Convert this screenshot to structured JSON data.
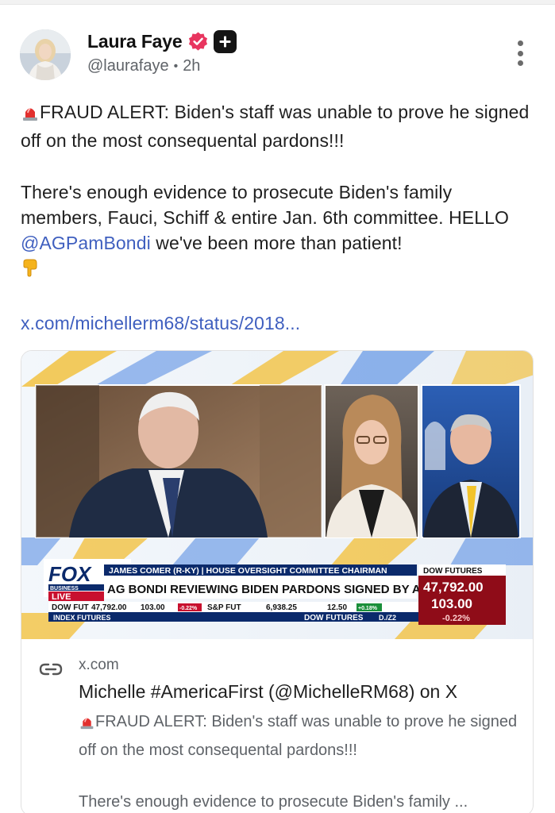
{
  "post": {
    "author": {
      "name": "Laura Faye",
      "handle": "@laurafaye",
      "time": "2h"
    },
    "body": {
      "p1_prefix_emoji": "siren-emoji",
      "p1": "FRAUD ALERT: Biden's staff was unable to prove he signed off on the most consequental pardons!!!",
      "p2_a": "There's enough evidence to prosecute Biden's family members, Fauci, Schiff & entire Jan. 6th committee. HELLO ",
      "p2_mention": "@AGPamBondi",
      "p2_b": " we've been more than patient!",
      "p2_emoji": "pointing-down-emoji",
      "link": "x.com/michellerm68/status/2018..."
    },
    "card": {
      "domain": "x.com",
      "title": "Michelle #AmericaFirst (@MichelleRM68) on X",
      "desc_1": "FRAUD ALERT: Biden's staff was unable to prove he signed off on the most consequental pardons!!!",
      "desc_2": "There's enough evidence to prosecute Biden's family ...",
      "image": {
        "network_logo": "FOX",
        "network_sub": "BUSINESS",
        "live": "LIVE",
        "speaker": "JAMES COMER (R-KY) | HOUSE OVERSIGHT COMMITTEE CHAIRMAN",
        "headline": "AG BONDI REVIEWING BIDEN PARDONS SIGNED BY AUTOPEN",
        "futures_label": "DOW FUTURES",
        "futures_value": "47,792.00",
        "futures_change": "103.00",
        "futures_pct": "-0.22%",
        "ticker_dow": "DOW FUT",
        "ticker_dow_val": "47,792.00",
        "ticker_dow_chg": "103.00",
        "ticker_dow_pct": "-0.22%",
        "ticker_sp": "S&P FUT",
        "ticker_sp_val": "6,938.25",
        "ticker_sp_chg": "12.50",
        "ticker_sp_pct": "+0.18%",
        "index_futures": "INDEX FUTURES",
        "dow_futures_footer": "DOW FUTURES",
        "dow_futures_footer_code": "D./Z2"
      }
    }
  },
  "colors": {
    "link": "#3f5fbf",
    "verified": "#e8355f",
    "fox_navy": "#0b2a6b",
    "fox_red": "#c8102e"
  }
}
